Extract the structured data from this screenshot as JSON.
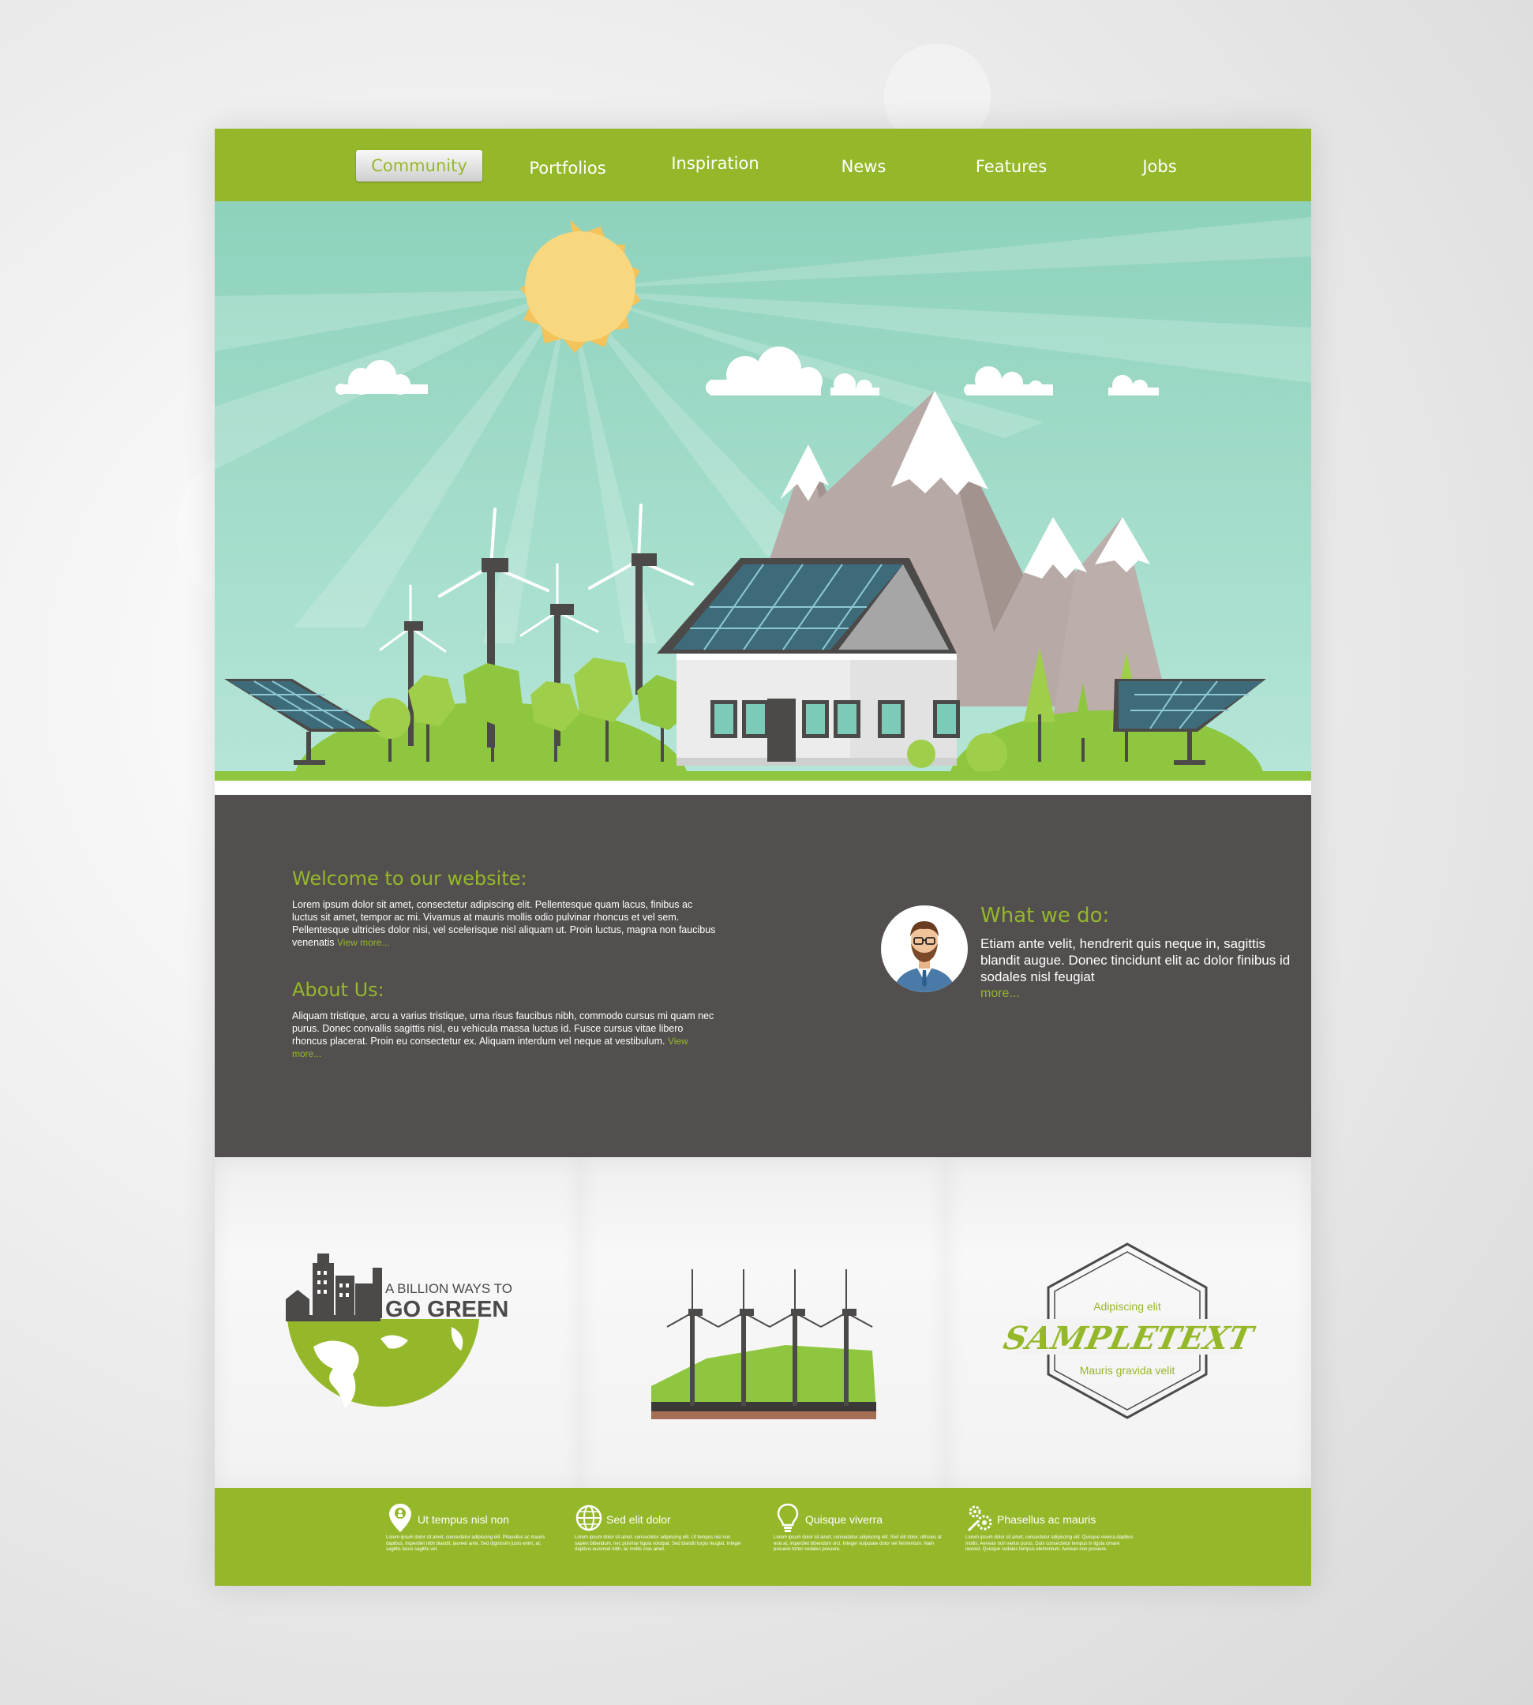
{
  "nav": {
    "items": [
      "Community",
      "Portfolios",
      "Inspiration",
      "News",
      "Features",
      "Jobs"
    ],
    "active_index": 0
  },
  "colors": {
    "brand_green": "#95b82a",
    "dark_panel": "#524f4e",
    "sky": "#93d4c0"
  },
  "welcome": {
    "title": "Welcome to our website:",
    "text": "Lorem ipsum dolor sit amet, consectetur adipiscing elit. Pellentesque quam lacus, finibus ac luctus sit amet, tempor ac mi. Vivamus at mauris mollis odio pulvinar rhoncus et vel sem. Pellentesque ultricies dolor nisi, vel scelerisque nisl aliquam ut. Proin luctus, magna non faucibus venenatis",
    "link": "View more..."
  },
  "about": {
    "title": "About Us:",
    "text": "Aliquam tristique, arcu a varius tristique, urna risus faucibus nibh, commodo cursus mi quam nec purus. Donec convallis sagittis nisl, eu vehicula massa luctus id. Fusce cursus vitae libero rhoncus placerat. Proin eu consectetur ex. Aliquam interdum vel neque at vestibulum.",
    "link": "View more..."
  },
  "what": {
    "title": "What we do:",
    "text": "Etiam ante velit, hendrerit quis neque in, sagittis blandit augue. Donec tincidunt elit ac dolor finibus  id sodales nisl feugiat",
    "link": "more..."
  },
  "cards": {
    "go_green_small": "A BILLION WAYS TO",
    "go_green_big": "GO GREEN",
    "badge_top": "Adipiscing elit",
    "badge_main": "SAMPLETEXT",
    "badge_bottom": "Mauris gravida velit"
  },
  "footer": {
    "features": [
      {
        "icon": "map-pin-icon",
        "title": "Ut tempus nisl non",
        "text": "Lorem ipsum dolor sit amet, consectetur adipiscing elit. Phasellus ac mauris dapibus, imperdiet nibh blandit, laoreet ante. Sed dignissim justo enim, ac sagittis lacus sagittis vel."
      },
      {
        "icon": "globe-icon",
        "title": "Sed elit dolor",
        "text": "Lorem ipsum dolor sit amet, consectetur adipiscing elit. Ut tempus nisl non sapien bibendum, nec pulvinar ligula volutpat. Sed blandit turpis feugiat. Integer dapibus euismod nibh, ac mollis cras amet."
      },
      {
        "icon": "lightbulb-icon",
        "title": "Quisque viverra",
        "text": "Lorem ipsum dolor sit amet, consectetur adipiscing elit. Sed elit dolor, ultricies at erat at, imperdiet bibendum orci. Integer vulputate dolor vel fermentum. Nam posuere tortor sodales posuere."
      },
      {
        "icon": "gears-icon",
        "title": "Phasellus ac mauris",
        "text": "Lorem ipsum dolor sit amet, consectetur adipiscing elit. Quisque viverra dapibus mollis. Aenean non varius purus. Duis consectetur tempus in ligula ornare laoreet. Quisque sodales tempus elementum. Aenean non posuere."
      }
    ]
  }
}
